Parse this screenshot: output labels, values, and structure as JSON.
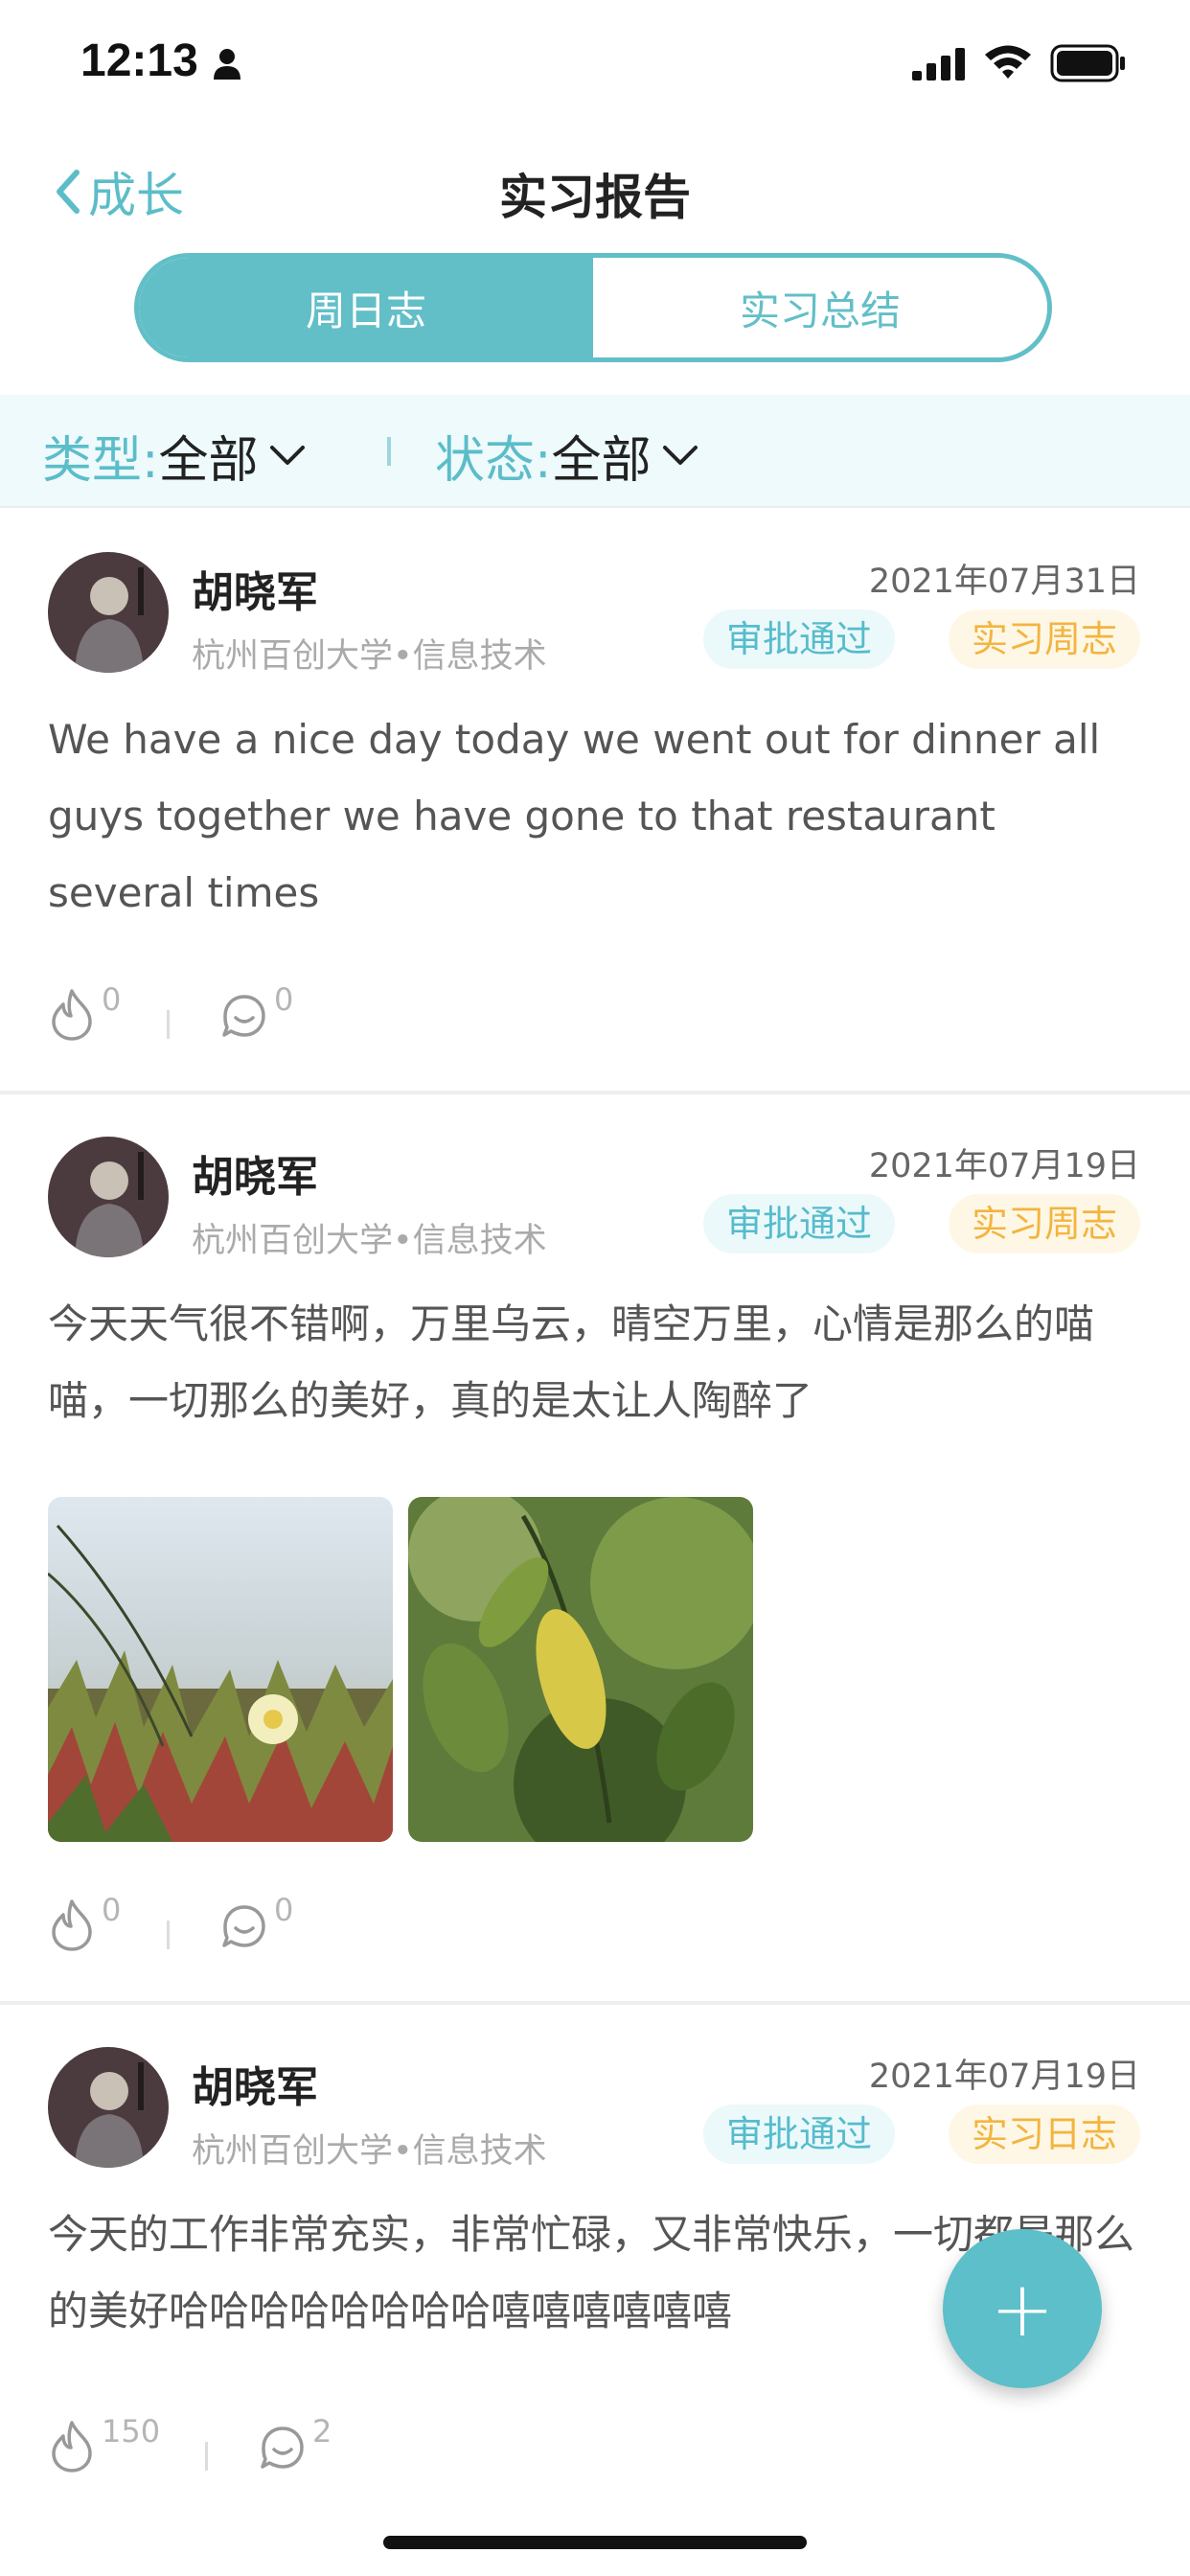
{
  "status": {
    "time": "12:13"
  },
  "nav": {
    "back_label": "成长",
    "title": "实习报告"
  },
  "tabs": [
    {
      "label": "周日志",
      "active": true
    },
    {
      "label": "实习总结",
      "active": false
    }
  ],
  "filter": {
    "type_label": "类型:",
    "type_value": "全部",
    "status_label": "状态:",
    "status_value": "全部"
  },
  "posts": [
    {
      "name": "胡晓军",
      "school": "杭州百创大学•信息技术",
      "date": "2021年07月31日",
      "status_tag": "审批通过",
      "type_tag": "实习周志",
      "content": "We have a nice day today we went out for dinner all guys together we have gone to that restaurant several times",
      "likes": "0",
      "comments": "0"
    },
    {
      "name": "胡晓军",
      "school": "杭州百创大学•信息技术",
      "date": "2021年07月19日",
      "status_tag": "审批通过",
      "type_tag": "实习周志",
      "content": "今天天气很不错啊，万里乌云，晴空万里，心情是那么的喵喵，一切那么的美好，真的是太让人陶醉了",
      "likes": "0",
      "comments": "0"
    },
    {
      "name": "胡晓军",
      "school": "杭州百创大学•信息技术",
      "date": "2021年07月19日",
      "status_tag": "审批通过",
      "type_tag": "实习日志",
      "content": "今天的工作非常充实，非常忙碌，又非常快乐，一切都是那么的美好哈哈哈哈哈哈哈哈嘻嘻嘻嘻嘻嘻",
      "likes": "150",
      "comments": "2"
    }
  ],
  "fab": {
    "label": "+"
  },
  "colors": {
    "accent": "#5cbdc9",
    "tag_yellow": "#f2b540"
  }
}
